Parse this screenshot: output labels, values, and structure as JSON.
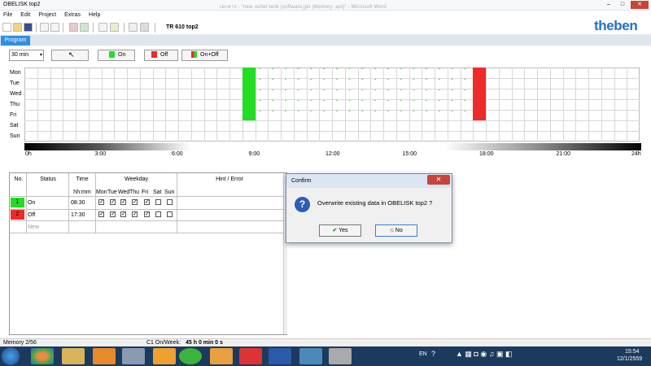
{
  "window": {
    "title": "OBELISK top2",
    "ghost_title": "เอกสาร - \"new outlet tardi (software.jpn (Memory .aut)\" - Microsoft Word",
    "minimize": "–",
    "maximize": "□",
    "close": "✕"
  },
  "menu": [
    "File",
    "Edit",
    "Project",
    "Extras",
    "Help"
  ],
  "toolbar": {
    "model": "TR 610 top2",
    "logo": "theben"
  },
  "tabs": {
    "program": "Program"
  },
  "controls": {
    "interval": "30 min",
    "on_label": "On",
    "off_label": "Off",
    "onoff_label": "On+Off",
    "on_color": "#22dd22",
    "off_color": "#ee2a2a"
  },
  "schedule": {
    "days": [
      "Mon",
      "Tue",
      "Wed",
      "Thu",
      "Fri",
      "Sat",
      "Sun"
    ],
    "time_labels": [
      "0h",
      "3:00",
      "6:00",
      "9:00",
      "12:00",
      "15:00",
      "18:00",
      "21:00",
      "24h"
    ],
    "active_days": [
      "Mon",
      "Tue",
      "Wed",
      "Thu",
      "Fri"
    ],
    "on_time": "08:30",
    "off_time": "17:30"
  },
  "table": {
    "headers": {
      "no": "No.",
      "status": "Status",
      "time": "Time",
      "weekday": "Weekday",
      "hint": "Hint / Error"
    },
    "subheaders": {
      "time": "hh:mm",
      "days": [
        "Mon",
        "Tue",
        "Wed",
        "Thu",
        "Fri",
        "Sat",
        "Sun"
      ]
    },
    "rows": [
      {
        "no": "1",
        "status": "On",
        "time": "08:30",
        "days": [
          true,
          true,
          true,
          true,
          true,
          false,
          false
        ],
        "color": "#22dd22"
      },
      {
        "no": "2",
        "status": "Off",
        "time": "17:30",
        "days": [
          true,
          true,
          true,
          true,
          true,
          false,
          false
        ],
        "color": "#ee2a2a"
      }
    ],
    "new_row": "New"
  },
  "dialog": {
    "title": "Confirm",
    "message": "Overwrite existing data in OBELISK top2 ?",
    "yes": "Yes",
    "no": "No",
    "close": "✕"
  },
  "statusbar": {
    "memory": "Memory 2/56",
    "c1_label": "C1 On/Week:",
    "c1_value": "45 h  0 min  0 s"
  },
  "taskbar": {
    "lang": "EN",
    "time": "15:54",
    "date": "12/1/2559"
  }
}
